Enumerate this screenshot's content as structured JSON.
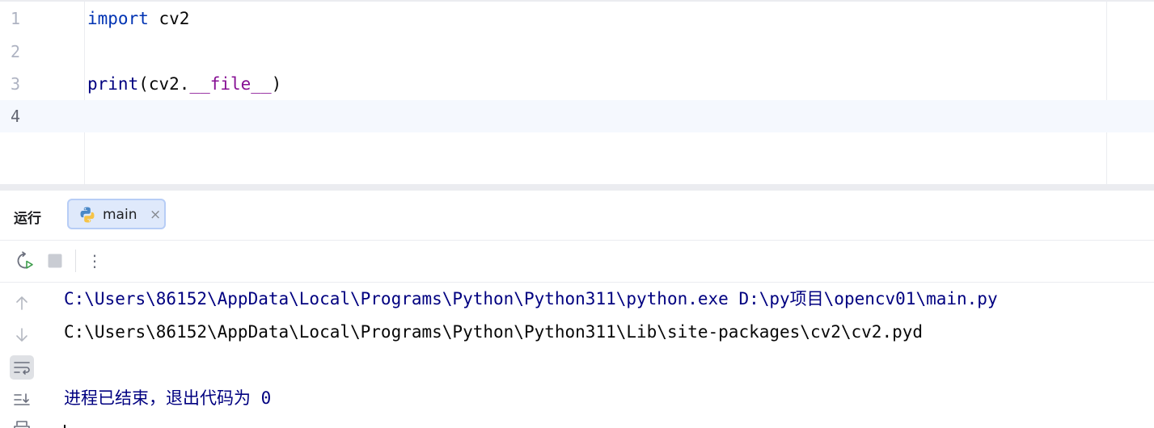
{
  "editor": {
    "lines": [
      {
        "number": "1",
        "tokens": [
          {
            "text": "import",
            "kind": "kw"
          },
          {
            "text": " cv2",
            "kind": "plain"
          }
        ]
      },
      {
        "number": "2",
        "tokens": []
      },
      {
        "number": "3",
        "tokens": [
          {
            "text": "print",
            "kind": "fn"
          },
          {
            "text": "(cv2.",
            "kind": "plain"
          },
          {
            "text": "__file__",
            "kind": "dunder"
          },
          {
            "text": ")",
            "kind": "plain"
          }
        ]
      },
      {
        "number": "4",
        "tokens": []
      }
    ],
    "current_line": "4"
  },
  "run_panel": {
    "title": "运行",
    "tab": {
      "label": "main",
      "icon": "python-icon",
      "close": "×"
    },
    "toolbar": {
      "rerun_icon": "rerun-icon",
      "stop_icon": "stop-icon",
      "more_icon": "more-vertical-icon",
      "more_glyph": "⋮"
    },
    "side_icons": [
      "arrow-up-icon",
      "arrow-down-icon",
      "soft-wrap-icon",
      "scroll-to-end-icon",
      "print-icon"
    ],
    "console": [
      {
        "kind": "cmd",
        "text": "C:\\Users\\86152\\AppData\\Local\\Programs\\Python\\Python311\\python.exe D:\\py项目\\opencv01\\main.py"
      },
      {
        "kind": "out",
        "text": "C:\\Users\\86152\\AppData\\Local\\Programs\\Python\\Python311\\Lib\\site-packages\\cv2\\cv2.pyd"
      },
      {
        "kind": "out",
        "text": ""
      },
      {
        "kind": "exit",
        "text": "进程已结束，退出代码为 0"
      }
    ]
  },
  "colors": {
    "keyword": "#0033b3",
    "builtin": "#000080",
    "dunder": "#871094",
    "tab_bg": "#dfe9fb",
    "tab_border": "#b7cdf6",
    "current_line_bg": "#f5f8fe"
  }
}
